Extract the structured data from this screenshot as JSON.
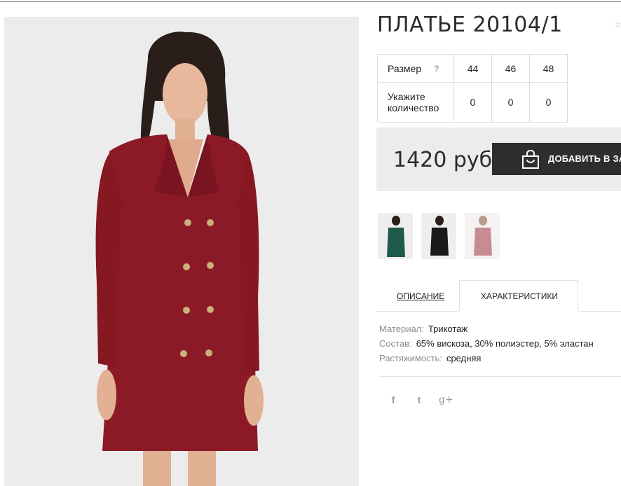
{
  "product": {
    "title": "ПЛАТЬЕ 20104/1",
    "image": "red double-breasted blazer dress with gold buttons, model photo"
  },
  "sizes": {
    "size_label": "Размер",
    "help": "?",
    "values": [
      "44",
      "46",
      "48"
    ],
    "qty_label": "Укажите количество",
    "quantities": [
      "0",
      "0",
      "0"
    ]
  },
  "purchase": {
    "price": "1420 руб",
    "button_label": "ДОБАВИТЬ В ЗАК",
    "button_icon": "shopping-bag-icon"
  },
  "thumbnails": [
    {
      "name": "green-dress-thumbnail",
      "color": "#1f5a4c"
    },
    {
      "name": "black-dress-thumbnail",
      "color": "#1a1a1a"
    },
    {
      "name": "red-dress-thumbnail",
      "color": "#8b1a26"
    }
  ],
  "tabs": {
    "description": "ОПИСАНИЕ",
    "characteristics": "ХАРАКТЕРИСТИКИ",
    "active": "characteristics"
  },
  "specs": [
    {
      "key": "Материал:",
      "value": "Трикотаж"
    },
    {
      "key": "Состав:",
      "value": "65% вискоза, 30% полиэстер, 5% эластан"
    },
    {
      "key": "Растяжимость:",
      "value": "средняя"
    }
  ],
  "social": {
    "facebook": "f",
    "twitter": "t",
    "googleplus": "g+"
  },
  "colors": {
    "dress": "#8b1a26",
    "button_bg": "#2e2e2e",
    "price_bg": "#ececec"
  }
}
